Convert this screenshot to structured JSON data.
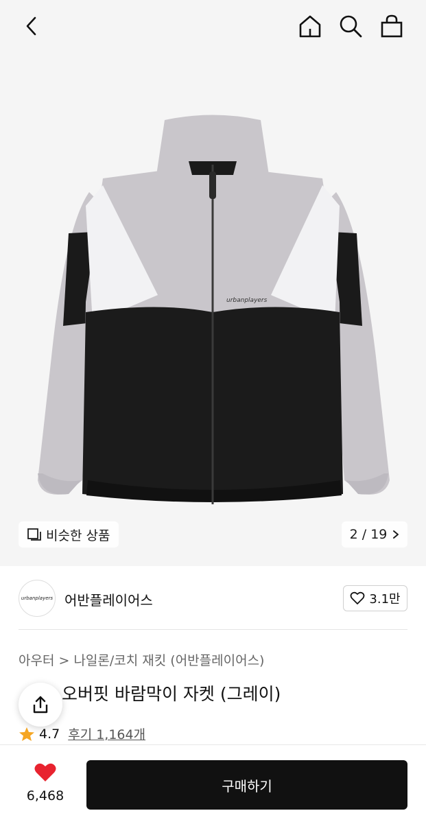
{
  "header": {
    "back_icon": "chevron-left-icon",
    "home_icon": "home-icon",
    "search_icon": "search-icon",
    "bag_icon": "shopping-bag-icon"
  },
  "gallery": {
    "similar_label": "비슷한 상품",
    "counter": "2 / 19",
    "jacket_logo_text": "urbanplayers"
  },
  "brand": {
    "logo_text": "urbanplayers",
    "name": "어반플레이어스",
    "like_count": "3.1만"
  },
  "product": {
    "breadcrumb": "아우터 > 나일론/코치 재킷 (어반플레이어스)",
    "title": "오버핏 바람막이 자켓 (그레이)",
    "rating": "4.7",
    "review_label": "후기 1,164개"
  },
  "bottom_bar": {
    "wish_count": "6,468",
    "buy_label": "구매하기"
  },
  "colors": {
    "accent_heart": "#e8232f",
    "star": "#f5a623",
    "buy_button": "#111111"
  }
}
